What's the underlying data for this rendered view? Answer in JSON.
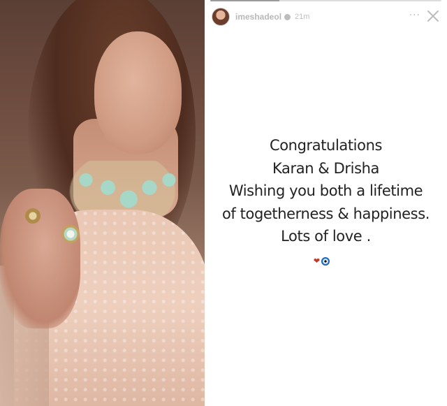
{
  "story": {
    "username": "imeshadeol",
    "timestamp": "21m",
    "progress": 0.3,
    "more_symbol": "···",
    "message_lines": [
      "Congratulations",
      "Karan & Drisha",
      "Wishing you both a lifetime",
      "of togetherness & happiness.",
      "Lots of love ."
    ],
    "emojis": [
      "red-heart",
      "evil-eye"
    ]
  },
  "colors": {
    "background": "#ffffff",
    "text": "#222222",
    "header_text": "#b8b8b8",
    "heart": "#c0392b",
    "nazar_blue": "#1f5fbf"
  },
  "icons": [
    "verified-badge-icon",
    "more-options-icon",
    "close-icon"
  ]
}
